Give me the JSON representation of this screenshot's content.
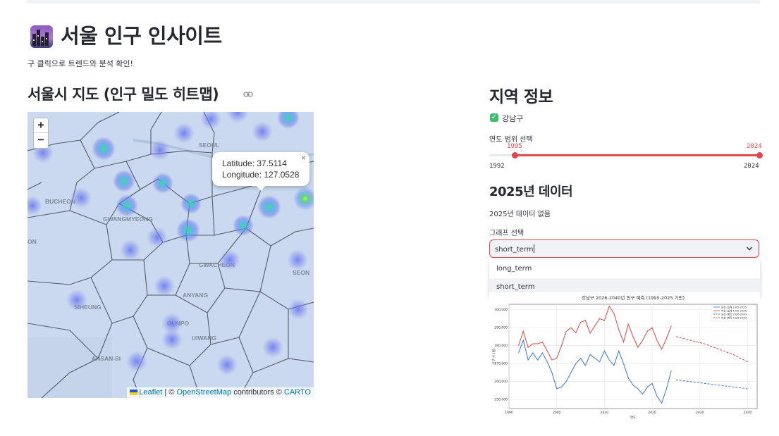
{
  "header": {
    "title": "서울 인구 인사이트",
    "subtitle": "구 클릭으로 트렌드와 분석 확인!"
  },
  "map_section": {
    "title": "서울시 지도 (인구 밀도 히트맵)",
    "zoom_in": "+",
    "zoom_out": "−",
    "popup": {
      "latitude": "Latitude: 37.5114",
      "longitude": "Longitude: 127.0528",
      "close": "×"
    },
    "place_labels": [
      "SEOUL",
      "BUCHEON",
      "GWANGMYEONG",
      "ON",
      "GWACHEON",
      "SEON",
      "ANYANG",
      "SIHEUNG",
      "GUNPO",
      "UIWANG",
      "ANSAN-SI"
    ],
    "attribution": {
      "leaflet": "Leaflet",
      "sep1": " | © ",
      "osm": "OpenStreetMap",
      "mid": " contributors © ",
      "carto": "CARTO"
    }
  },
  "region_info": {
    "title": "지역 정보",
    "checkbox_label": "강남구",
    "checkbox_checked": true,
    "slider": {
      "label": "연도 범위 선택",
      "min": 1992,
      "max": 2024,
      "selected_low": 1995,
      "selected_high": 2024,
      "min_label": "1992",
      "max_label": "2024",
      "low_label": "1995",
      "high_label": "2024",
      "color": "#e0474c"
    }
  },
  "data_section": {
    "title": "2025년 데이터",
    "no_data": "2025년 데이터 없음",
    "graph_select_label": "그래프 선택",
    "select_value": "short_term",
    "options": [
      "long_term",
      "short_term"
    ]
  },
  "chart_data": {
    "type": "line",
    "title": "강남구 2026-2040년 인구 예측 (1995-2025 기반)",
    "xlabel": "연도",
    "ylabel": "인구 수 (명)",
    "xlim": [
      1990,
      2042
    ],
    "ylim": [
      245000,
      303000
    ],
    "xticks": [
      "1990",
      "2000",
      "2010",
      "2020",
      "2030",
      "2040"
    ],
    "yticks": [
      "250,000",
      "260,000",
      "270,000",
      "280,000",
      "290,000",
      "300,000"
    ],
    "legend_position": "top-right",
    "series": [
      {
        "name": "남성 (실제 1995-2025)",
        "style": "solid",
        "color": "#4a7fc9",
        "x": [
          1992,
          1993,
          1994,
          1995,
          1996,
          1997,
          1998,
          1999,
          2000,
          2001,
          2002,
          2003,
          2004,
          2005,
          2006,
          2007,
          2008,
          2009,
          2010,
          2011,
          2012,
          2013,
          2014,
          2015,
          2016,
          2017,
          2018,
          2019,
          2020,
          2021,
          2022,
          2023,
          2024
        ],
        "y": [
          276000,
          283000,
          272000,
          276000,
          272000,
          276000,
          271000,
          265000,
          256000,
          257000,
          260000,
          265000,
          270000,
          273000,
          269000,
          275000,
          273000,
          271000,
          277000,
          272000,
          269000,
          277000,
          270000,
          262000,
          258000,
          256000,
          253000,
          257000,
          259000,
          252000,
          248000,
          256000,
          266000
        ]
      },
      {
        "name": "여성 (실제 1995-2025)",
        "style": "solid",
        "color": "#d9534f",
        "x": [
          1992,
          1993,
          1994,
          1995,
          1996,
          1997,
          1998,
          1999,
          2000,
          2001,
          2002,
          2003,
          2004,
          2005,
          2006,
          2007,
          2008,
          2009,
          2010,
          2011,
          2012,
          2013,
          2014,
          2015,
          2016,
          2017,
          2018,
          2019,
          2020,
          2021,
          2022,
          2023,
          2024
        ],
        "y": [
          280000,
          288000,
          279000,
          281000,
          281000,
          282000,
          277000,
          272000,
          273000,
          280000,
          288000,
          290000,
          287000,
          293000,
          294000,
          287000,
          291000,
          295000,
          294000,
          302000,
          298000,
          289000,
          282000,
          292000,
          285000,
          279000,
          283000,
          288000,
          290000,
          283000,
          278000,
          284000,
          291000
        ]
      },
      {
        "name": "남성 (예측 2026-2040)",
        "style": "dashed",
        "color": "#4a7fc9",
        "x": [
          2025,
          2028,
          2031,
          2034,
          2037,
          2040
        ],
        "y": [
          261000,
          260000,
          259000,
          258000,
          257000,
          256000
        ]
      },
      {
        "name": "여성 (예측 2026-2040)",
        "style": "dashed",
        "color": "#d9534f",
        "x": [
          2025,
          2028,
          2031,
          2034,
          2037,
          2040
        ],
        "y": [
          285000,
          283000,
          281000,
          278000,
          275000,
          271000
        ]
      }
    ]
  }
}
